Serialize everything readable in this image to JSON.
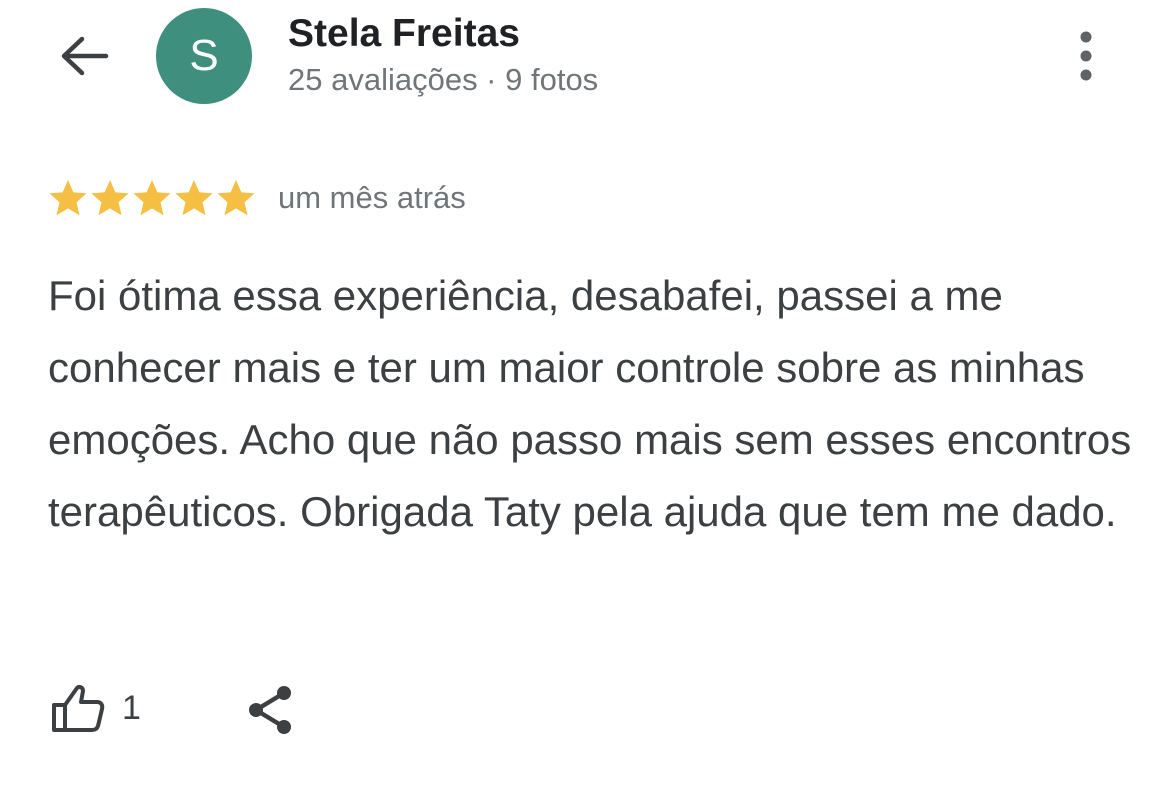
{
  "header": {
    "back_icon": "arrow-back-icon",
    "avatar_letter": "S",
    "avatar_color": "#3f8f7f",
    "name": "Stela Freitas",
    "meta": "25 avaliações · 9 fotos",
    "more_icon": "more-vert-icon"
  },
  "review": {
    "rating": 5,
    "rating_max": 5,
    "star_color": "#f4bf42",
    "date": "um mês atrás",
    "text": "Foi ótima essa experiência, desabafei, passei a me conhecer mais e ter um maior controle sobre as minhas emoções. Acho que não passo mais sem esses encontros terapêuticos. Obrigada Taty pela ajuda que tem me dado."
  },
  "actions": {
    "like_icon": "thumb-up-icon",
    "like_count": "1",
    "share_icon": "share-icon"
  }
}
